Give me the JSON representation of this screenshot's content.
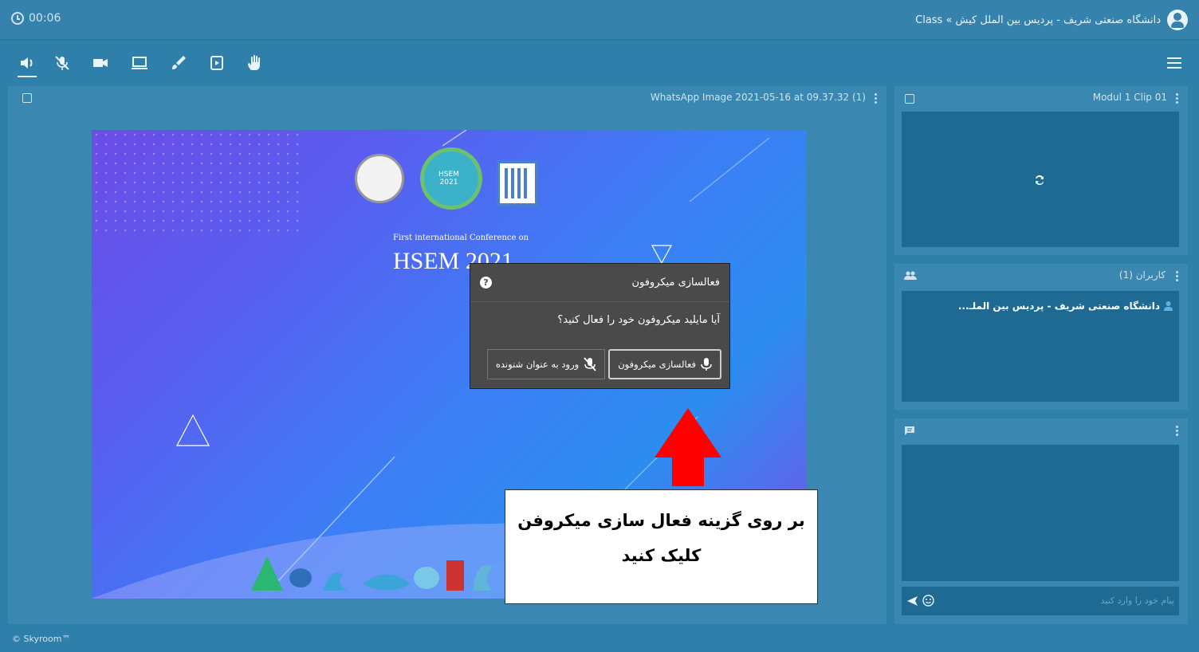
{
  "header": {
    "timer": "00:06",
    "room_title": "دانشگاه صنعتی شریف - پردیس بین الملل کیش » Class"
  },
  "toolbar": {
    "icons": [
      "speaker-icon",
      "mic-off-icon",
      "camera-icon",
      "screen-share-icon",
      "brush-icon",
      "media-play-icon",
      "raise-hand-icon"
    ],
    "menu_icon": "menu-icon"
  },
  "main_panel": {
    "file_title": "WhatsApp Image 2021-05-16 at 09.37.32 (1)"
  },
  "slide": {
    "subtitle": "First international Conference on",
    "heading": "HSEM 2021",
    "logo_text": "HSEM\n2021"
  },
  "dialog": {
    "title": "فعالسازی میکروفون",
    "help": "?",
    "question": "آیا مایلید میکروفون خود را فعال کنید؟",
    "primary_button": "فعالسازی میکروفون",
    "secondary_button": "ورود به عنوان شنونده"
  },
  "callout": {
    "line1": "بر روی گزینه فعال سازی میکروفن",
    "line2": "کلیک کنید"
  },
  "video_panel": {
    "title": "Modul 1 Clip 01"
  },
  "users_panel": {
    "title": "کاربران (1)",
    "users": [
      "دانشگاه صنعتی شریف - پردیس بین الملـ..."
    ]
  },
  "chat_panel": {
    "placeholder": "پیام خود را وارد کنید"
  },
  "footer": {
    "brand": "© Skyroom™"
  },
  "colors": {
    "app_bg": "#2f7fab",
    "panel_bg": "#3a88b2",
    "dark_area": "#1e6a93",
    "dialog_bg": "#4a4a4a",
    "arrow": "#ff0000"
  }
}
